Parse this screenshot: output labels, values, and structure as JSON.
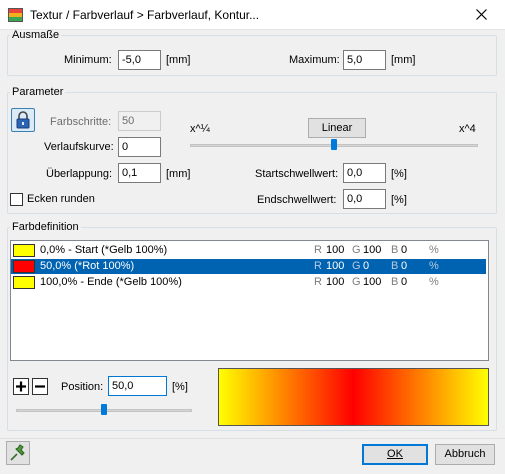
{
  "window": {
    "title": "Textur / Farbverlauf > Farbverlauf, Kontur...",
    "close_icon": "close-icon"
  },
  "ausmasse": {
    "legend": "Ausmaße",
    "minimum_label": "Minimum:",
    "minimum_value": "-5,0",
    "minimum_unit": "[mm]",
    "maximum_label": "Maximum:",
    "maximum_value": "5,0",
    "maximum_unit": "[mm]"
  },
  "parameter": {
    "legend": "Parameter",
    "lock_icon": "lock-icon",
    "farbschritte_label": "Farbschritte:",
    "farbschritte_value": "50",
    "verlaufskurve_label": "Verlaufskurve:",
    "verlaufskurve_value": "0",
    "ueberlappung_label": "Überlappung:",
    "ueberlappung_value": "0,1",
    "ueberlappung_unit": "[mm]",
    "ecken_runden_label": "Ecken runden",
    "ecken_runden_checked": false,
    "curve_min_label": "x^¼",
    "curve_max_label": "x^4",
    "linear_button": "Linear",
    "curve_slider_value": 0.5,
    "startschwellwert_label": "Startschwellwert:",
    "startschwellwert_value": "0,0",
    "startschwellwert_unit": "[%]",
    "endschwellwert_label": "Endschwellwert:",
    "endschwellwert_value": "0,0",
    "endschwellwert_unit": "[%]"
  },
  "farbdefinition": {
    "legend": "Farbdefinition",
    "entries": [
      {
        "swatch": "#ffff00",
        "name": "0,0% - Start (*Gelb 100%)",
        "r": "R",
        "r_val": "100",
        "g": "G",
        "g_val": "100",
        "b": "B",
        "b_val": "0",
        "pct": "%",
        "selected": false
      },
      {
        "swatch": "#ff0000",
        "name": "50,0% (*Rot 100%)",
        "r": "R",
        "r_val": "100",
        "g": "G",
        "g_val": "0",
        "b": "B",
        "b_val": "0",
        "pct": "%",
        "selected": true
      },
      {
        "swatch": "#ffff00",
        "name": "100,0% - Ende (*Gelb 100%)",
        "r": "R",
        "r_val": "100",
        "g": "G",
        "g_val": "100",
        "b": "B",
        "b_val": "0",
        "pct": "%",
        "selected": false
      }
    ],
    "add_icon": "plus-icon",
    "remove_icon": "minus-icon",
    "position_label": "Position:",
    "position_value": "50,0",
    "position_unit": "[%]",
    "position_slider_value": 0.5,
    "gradient_colors": [
      "#ffff00",
      "#ff0000",
      "#ffff00"
    ]
  },
  "footer": {
    "pin_icon": "pin-icon",
    "ok_label": "OK",
    "cancel_label": "Abbruch"
  }
}
